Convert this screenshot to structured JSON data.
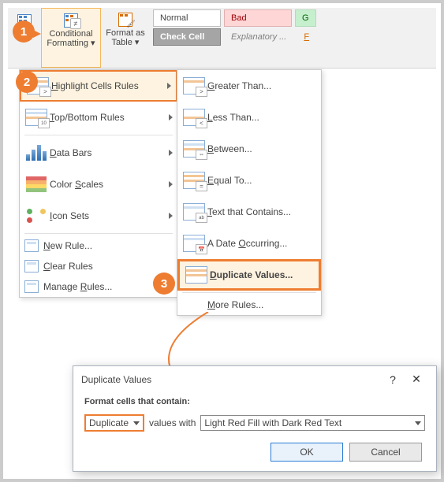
{
  "ribbon": {
    "conditional_formatting": "Conditional\nFormatting",
    "format_as_table": "Format as\nTable",
    "styles": {
      "normal": "Normal",
      "bad": "Bad",
      "good": "G",
      "check_cell": "Check Cell",
      "explanatory": "Explanatory ...",
      "followed_link": "F"
    }
  },
  "menu": {
    "highlight": "Highlight Cells Rules",
    "topbottom": "Top/Bottom Rules",
    "databars": "Data Bars",
    "colorscales": "Color Scales",
    "iconsets": "Icon Sets",
    "new_rule": "New Rule...",
    "clear_rules": "Clear Rules",
    "manage_rules": "Manage Rules..."
  },
  "submenu": {
    "greater_than": "Greater Than...",
    "less_than": "Less Than...",
    "between": "Between...",
    "equal_to": "Equal To...",
    "text_contains": "Text that Contains...",
    "date_occurring": "A Date Occurring...",
    "duplicate_values": "Duplicate Values...",
    "more_rules": "More Rules..."
  },
  "callouts": {
    "one": "1",
    "two": "2",
    "three": "3"
  },
  "dialog": {
    "title": "Duplicate Values",
    "instruction": "Format cells that contain:",
    "type_selected": "Duplicate",
    "values_with": "values with",
    "format_selected": "Light Red Fill with Dark Red Text",
    "ok": "OK",
    "cancel": "Cancel"
  }
}
